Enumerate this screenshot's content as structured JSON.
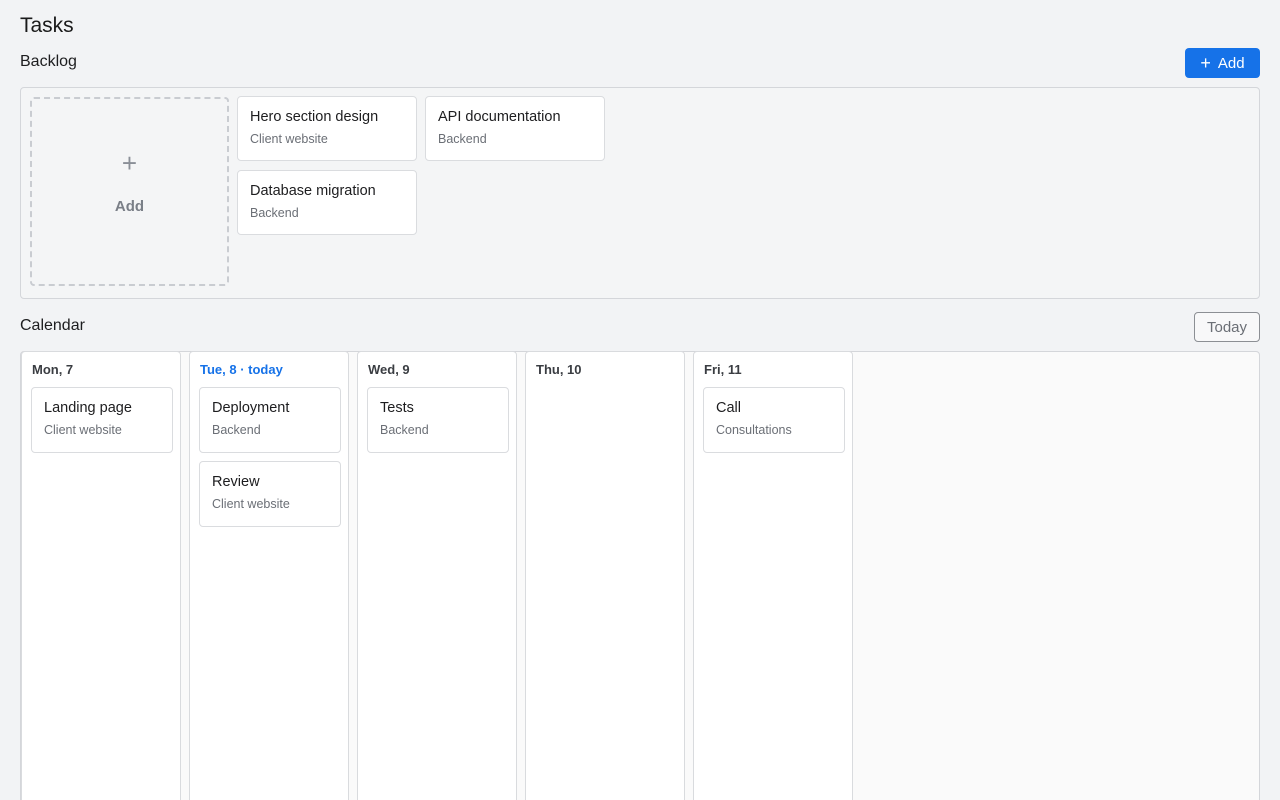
{
  "page": {
    "title": "Tasks"
  },
  "backlog": {
    "title": "Backlog",
    "add_button": "Add",
    "add_tile_label": "Add",
    "cards": [
      {
        "title": "Hero section design",
        "project": "Client website"
      },
      {
        "title": "API documentation",
        "project": "Backend"
      },
      {
        "title": "Database migration",
        "project": "Backend"
      }
    ]
  },
  "calendar": {
    "title": "Calendar",
    "today_button": "Today",
    "days": [
      {
        "label": "Mon, 7",
        "is_today": false,
        "tasks": [
          {
            "title": "Landing page",
            "project": "Client website"
          }
        ]
      },
      {
        "label": "Tue, 8 · today",
        "is_today": true,
        "tasks": [
          {
            "title": "Deployment",
            "project": "Backend"
          },
          {
            "title": "Review",
            "project": "Client website"
          }
        ]
      },
      {
        "label": "Wed, 9",
        "is_today": false,
        "tasks": [
          {
            "title": "Tests",
            "project": "Backend"
          }
        ]
      },
      {
        "label": "Thu, 10",
        "is_today": false,
        "tasks": []
      },
      {
        "label": "Fri, 11",
        "is_today": false,
        "tasks": [
          {
            "title": "Call",
            "project": "Consultations"
          }
        ]
      }
    ]
  },
  "colors": {
    "accent": "#1672e8",
    "background": "#f2f3f5",
    "card": "#ffffff"
  },
  "icons": {
    "add": "plus-icon"
  }
}
